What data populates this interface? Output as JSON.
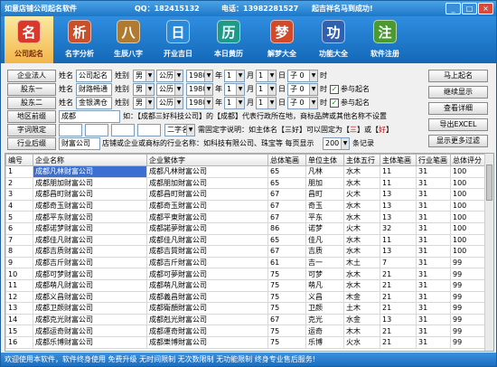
{
  "window": {
    "title": "如意店铺公司起名软件",
    "qq": "QQ：18241513​2",
    "phone": "电话：13982281527",
    "slogan": "起吉祥名马到成功!",
    "min": "_",
    "max": "□",
    "close": "×"
  },
  "toolbar": [
    {
      "label": "公司起名",
      "icon": "名"
    },
    {
      "label": "名字分析",
      "icon": "析"
    },
    {
      "label": "生辰八字",
      "icon": "八"
    },
    {
      "label": "开业吉日",
      "icon": "日"
    },
    {
      "label": "本日黄历",
      "icon": "历"
    },
    {
      "label": "解梦大全",
      "icon": "梦"
    },
    {
      "label": "功能大全",
      "icon": "功"
    },
    {
      "label": "软件注册",
      "icon": "注"
    }
  ],
  "form": {
    "btn_legal": "企业法人",
    "btn_shareholder1": "股东一",
    "btn_shareholder2": "股东二",
    "btn_region": "地区前缀",
    "btn_word_limit": "字词限定",
    "btn_industry": "行业后缀",
    "lbl_name": "姓名",
    "lbl_gender": "姓别",
    "lbl_year": "年",
    "lbl_month": "月",
    "lbl_day": "日",
    "lbl_hour": "时",
    "lbl_join": "参与起名",
    "person1": {
      "name": "公司起名",
      "gender": "男",
      "cal": "公历",
      "year": "1980",
      "month": "1",
      "day": "1",
      "hour": "子 0"
    },
    "person2": {
      "name": "财路畅通",
      "gender": "男",
      "cal": "公历",
      "year": "1980",
      "month": "1",
      "day": "1",
      "hour": "子 0"
    },
    "person3": {
      "name": "金银满仓",
      "gender": "男",
      "cal": "公历",
      "year": "1980",
      "month": "1",
      "day": "1",
      "hour": "子 0"
    },
    "region_value": "成都",
    "region_note_prefix": "如：【成都三好科技公司】的【成都】代表行政所在地，商标品牌或其他名称不设置",
    "word_count": "二字名",
    "word_note_a": "需固定字说明：如主体名【三好】可以固定为【",
    "word_note_b": "三",
    "word_note_c": "】或【",
    "word_note_d": "好",
    "word_note_e": "】",
    "industry_value": "财富公司",
    "industry_note": "店铺或企业或商标的行业名称：如科技有限公司、珠宝等  每页显示",
    "page_size": "200",
    "page_unit": "条记录",
    "btn_start": "马上起名",
    "btn_continue": "继续显示",
    "btn_detail": "查看详细",
    "btn_export": "导出EXCEL",
    "btn_filter": "显示更多过滤"
  },
  "table": {
    "headers": [
      "编号",
      "企业名称",
      "企业繁体字",
      "总体笔画",
      "单位主体",
      "主体五行",
      "主体笔画",
      "行业笔画",
      "总体评分"
    ],
    "rows": [
      [
        "1",
        "成都凡林财富公司",
        "成都凡林財富公司",
        "65",
        "凡林",
        "水木",
        "11",
        "31",
        "100"
      ],
      [
        "2",
        "成都朋加财富公司",
        "成都朋加財富公司",
        "65",
        "朋加",
        "水木",
        "11",
        "31",
        "100"
      ],
      [
        "3",
        "成都昌町财富公司",
        "成都昌町財富公司",
        "67",
        "昌町",
        "火木",
        "13",
        "31",
        "100"
      ],
      [
        "4",
        "成都奇玉财富公司",
        "成都奇玉財富公司",
        "67",
        "奇玉",
        "水木",
        "13",
        "31",
        "100"
      ],
      [
        "5",
        "成都平东财富公司",
        "成都平東財富公司",
        "67",
        "平东",
        "水木",
        "13",
        "31",
        "100"
      ],
      [
        "6",
        "成都诺梦财富公司",
        "成都諾夢財富公司",
        "86",
        "诺梦",
        "火木",
        "32",
        "31",
        "100"
      ],
      [
        "7",
        "成都佳凡财富公司",
        "成都佳凡財富公司",
        "65",
        "佳凡",
        "水木",
        "11",
        "31",
        "100"
      ],
      [
        "8",
        "成都吉质财富公司",
        "成都吉質財富公司",
        "67",
        "吉质",
        "水木",
        "13",
        "31",
        "100"
      ],
      [
        "9",
        "成都吉斤财富公司",
        "成都吉斤財富公司",
        "61",
        "吉一",
        "木土",
        "7",
        "31",
        "99"
      ],
      [
        "10",
        "成都可梦财富公司",
        "成都可夢財富公司",
        "75",
        "可梦",
        "水木",
        "21",
        "31",
        "99"
      ],
      [
        "11",
        "成都萌凡财富公司",
        "成都萌凡財富公司",
        "75",
        "萌凡",
        "水木",
        "21",
        "31",
        "99"
      ],
      [
        "12",
        "成都义昌财富公司",
        "成都義昌財富公司",
        "75",
        "义昌",
        "木金",
        "21",
        "31",
        "99"
      ],
      [
        "13",
        "成都卫颜财富公司",
        "成都衛顏財富公司",
        "75",
        "卫颜",
        "土木",
        "21",
        "31",
        "99"
      ],
      [
        "14",
        "成都克光财富公司",
        "成都剋光財富公司",
        "67",
        "克光",
        "水金",
        "13",
        "31",
        "99"
      ],
      [
        "15",
        "成都运奇财富公司",
        "成都運奇財富公司",
        "75",
        "运奇",
        "木木",
        "21",
        "31",
        "99"
      ],
      [
        "16",
        "成都乐博财富公司",
        "成都樂博財富公司",
        "75",
        "乐博",
        "火水",
        "21",
        "31",
        "99"
      ]
    ]
  },
  "status": "欢迎使用本软件，软件终身使用 免费升级 无时间限制 无次数限制 无功能限制 终身专业售后服务!"
}
